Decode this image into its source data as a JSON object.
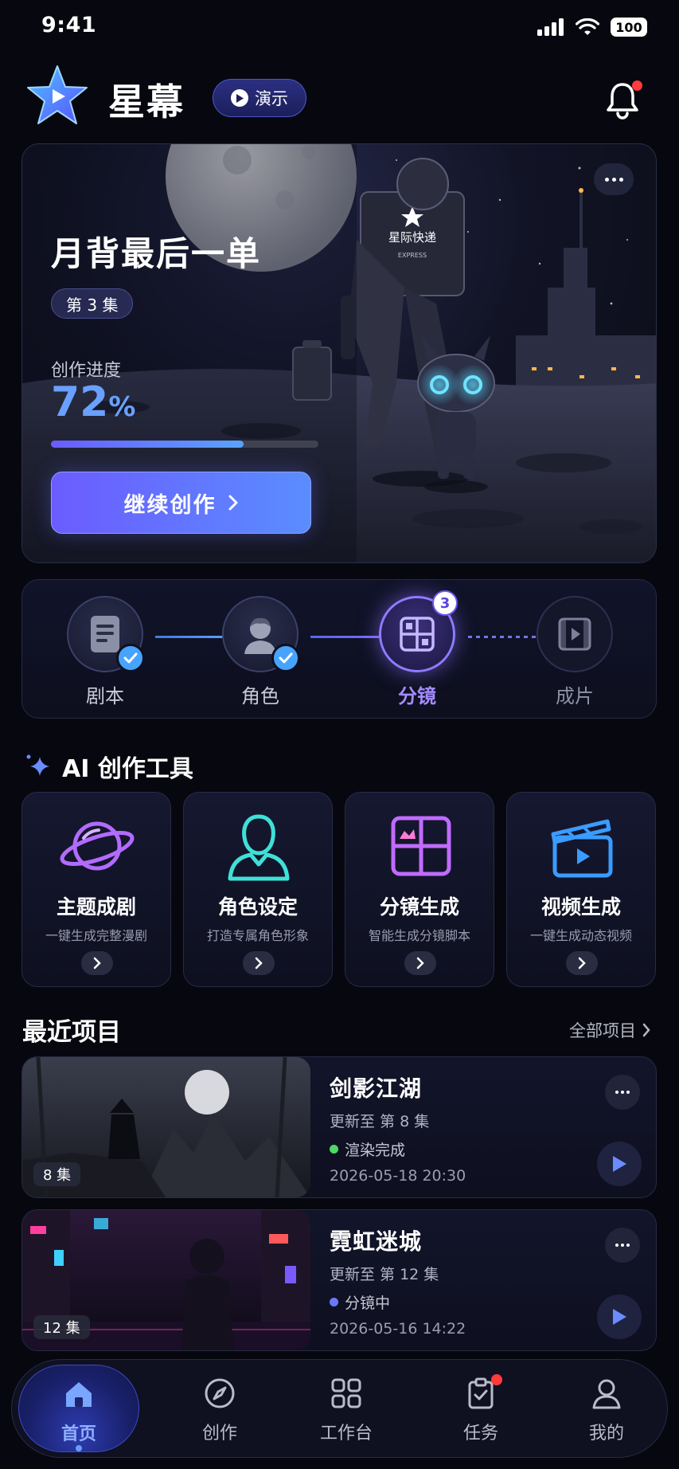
{
  "status": {
    "time": "9:41",
    "battery": "100"
  },
  "header": {
    "app_title": "星幕",
    "demo_label": "演示"
  },
  "hero": {
    "title": "月背最后一单",
    "episode": "第 3 集",
    "progress_label": "创作进度",
    "progress_value": "72",
    "progress_unit": "%",
    "progress_fraction": 0.72,
    "cta_label": "继续创作",
    "backpack_text": "星际快递",
    "backpack_subtext": "EXPRESS"
  },
  "pipeline": {
    "steps": [
      {
        "label": "剧本",
        "state": "done"
      },
      {
        "label": "角色",
        "state": "done"
      },
      {
        "label": "分镜",
        "state": "active",
        "badge": "3"
      },
      {
        "label": "成片",
        "state": "pending"
      }
    ]
  },
  "tools": {
    "section_title": "AI 创作工具",
    "items": [
      {
        "name": "主题成剧",
        "desc": "一键生成完整漫剧",
        "icon": "planet-icon",
        "color": "#b26bff"
      },
      {
        "name": "角色设定",
        "desc": "打造专属角色形象",
        "icon": "person-icon",
        "color": "#3fe0d8"
      },
      {
        "name": "分镜生成",
        "desc": "智能生成分镜脚本",
        "icon": "storyboard-icon",
        "color": "#c06bff"
      },
      {
        "name": "视频生成",
        "desc": "一键生成动态视频",
        "icon": "clapperboard-icon",
        "color": "#3a9cff"
      }
    ]
  },
  "recent": {
    "title": "最近项目",
    "all_label": "全部项目",
    "projects": [
      {
        "name": "剑影江湖",
        "update": "更新至  第 8 集",
        "episodes": "8 集",
        "status": "渲染完成",
        "status_color": "#4cd964",
        "time": "2026-05-18 20:30"
      },
      {
        "name": "霓虹迷城",
        "update": "更新至  第 12 集",
        "episodes": "12 集",
        "status": "分镜中",
        "status_color": "#6a78ff",
        "time": "2026-05-16 14:22"
      }
    ]
  },
  "tabs": [
    {
      "label": "首页",
      "icon": "home-icon",
      "active": true
    },
    {
      "label": "创作",
      "icon": "compass-icon"
    },
    {
      "label": "工作台",
      "icon": "grid-icon"
    },
    {
      "label": "任务",
      "icon": "clipboard-check-icon",
      "has_dot": true
    },
    {
      "label": "我的",
      "icon": "user-icon"
    }
  ]
}
